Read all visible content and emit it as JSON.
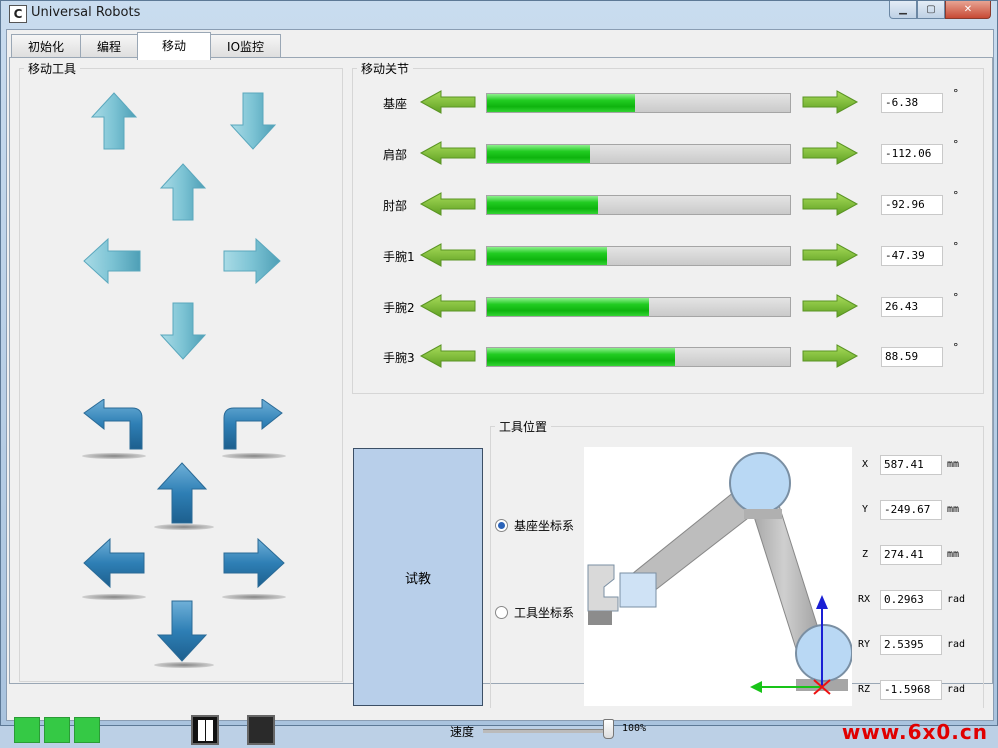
{
  "window": {
    "title": "Universal Robots",
    "icon_letter": "C"
  },
  "tabs": [
    {
      "label": "初始化",
      "active": false
    },
    {
      "label": "编程",
      "active": false
    },
    {
      "label": "移动",
      "active": true
    },
    {
      "label": "IO监控",
      "active": false
    }
  ],
  "move_tool": {
    "title": "移动工具"
  },
  "move_joints": {
    "title": "移动关节",
    "unit": "°",
    "joints": [
      {
        "label": "基座",
        "value": "-6.38",
        "level": 0.49
      },
      {
        "label": "肩部",
        "value": "-112.06",
        "level": 0.34
      },
      {
        "label": "肘部",
        "value": "-92.96",
        "level": 0.365
      },
      {
        "label": "手腕1",
        "value": "-47.39",
        "level": 0.395
      },
      {
        "label": "手腕2",
        "value": "26.43",
        "level": 0.535
      },
      {
        "label": "手腕3",
        "value": "88.59",
        "level": 0.62
      }
    ]
  },
  "tool_position": {
    "title": "工具位置",
    "teach_button": "试教",
    "frames": [
      {
        "label": "基座坐标系",
        "checked": true
      },
      {
        "label": "工具坐标系",
        "checked": false
      }
    ],
    "pose": [
      {
        "axis": "X",
        "value": "587.41",
        "unit": "mm"
      },
      {
        "axis": "Y",
        "value": "-249.67",
        "unit": "mm"
      },
      {
        "axis": "Z",
        "value": "274.41",
        "unit": "mm"
      },
      {
        "axis": "RX",
        "value": "0.2963",
        "unit": "rad"
      },
      {
        "axis": "RY",
        "value": "2.5395",
        "unit": "rad"
      },
      {
        "axis": "RZ",
        "value": "-1.5968",
        "unit": "rad"
      }
    ]
  },
  "status": {
    "speed_label": "速度",
    "speed_value": "100%",
    "speed_level": 1.0,
    "watermark": "www.6x0.cn"
  },
  "colors": {
    "led_green": "#35c945",
    "bar_green": "#0eb40e",
    "teach_bg": "#b8cfea",
    "watermark": "#e00000"
  }
}
